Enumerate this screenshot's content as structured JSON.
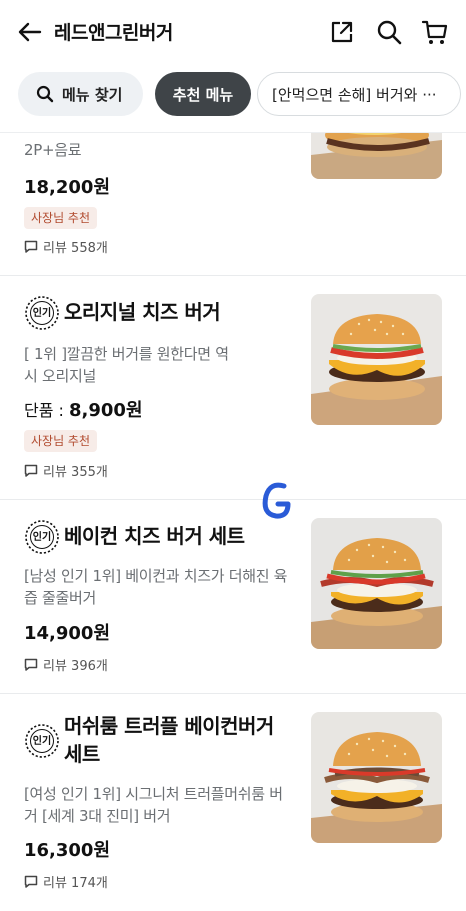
{
  "header": {
    "title": "레드앤그린버거"
  },
  "chips": {
    "search": "메뉴 찾기",
    "recommended": "추천 메뉴",
    "event": "[안먹으면 손해] 버거와 ···"
  },
  "items": [
    {
      "name": "",
      "desc": "2P+음료",
      "price": "18,200원",
      "owner_tag": "사장님 추천",
      "review": "리뷰 558개"
    },
    {
      "badge": "인기",
      "name": "오리지널 치즈 버거",
      "desc": "[ 1위 ]깔끔한 버거를 원한다면 역시 오리지널",
      "price_prefix": "단품 : ",
      "price": "8,900원",
      "owner_tag": "사장님 추천",
      "review": "리뷰 355개"
    },
    {
      "badge": "인기",
      "name": "베이컨 치즈 버거 세트",
      "desc": "[남성 인기 1위]  베이컨과 치즈가 더해진 육즙 줄줄버거",
      "price": "14,900원",
      "review": "리뷰 396개"
    },
    {
      "badge": "인기",
      "name": "머쉬룸 트러플 베이컨버거 세트",
      "desc": "[여성 인기 1위] 시그니처 트러플머쉬룸 버거 [세계 3대 진미] 버거",
      "price": "16,300원",
      "review": "리뷰 174개"
    }
  ],
  "colors": {
    "chip_active": "#3f4448",
    "owner_tag_bg": "#f7ece8",
    "owner_tag_text": "#b14a2e",
    "g_mark": "#2a5bd7"
  }
}
